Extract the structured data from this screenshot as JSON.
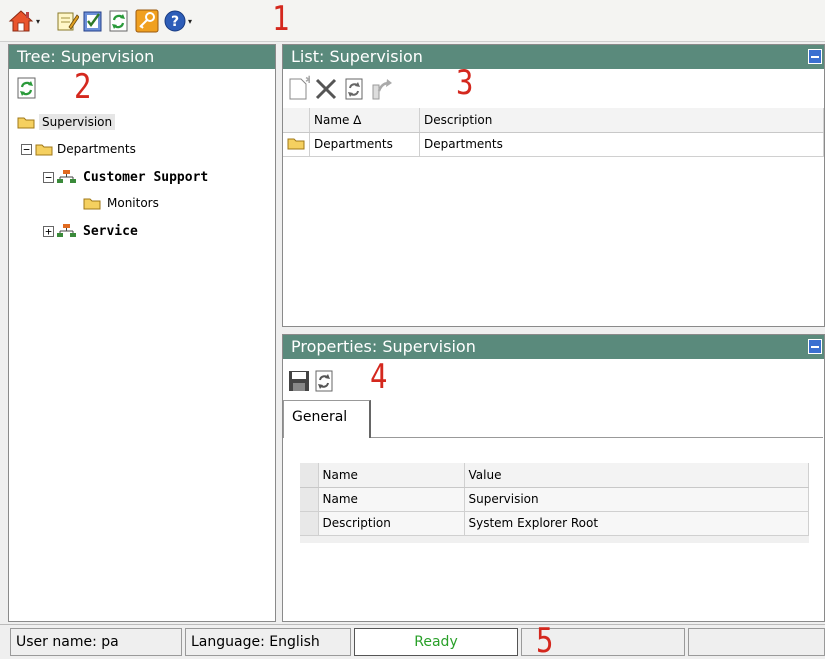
{
  "annotations": [
    "1",
    "2",
    "3",
    "4",
    "5"
  ],
  "toolbar": {
    "items": [
      {
        "icon": "home-icon"
      },
      {
        "icon": "edit-document-icon"
      },
      {
        "icon": "checklist-icon"
      },
      {
        "icon": "refresh-icon"
      },
      {
        "icon": "key-icon"
      },
      {
        "icon": "help-icon"
      }
    ]
  },
  "tree_panel": {
    "title": "Tree: Supervision",
    "refresh_icon": "refresh-icon",
    "nodes": [
      {
        "label": "Supervision",
        "icon": "folder-icon",
        "selected": true
      },
      {
        "label": "Departments",
        "icon": "folder-icon",
        "expander": "−"
      },
      {
        "label": "Customer Support",
        "icon": "org-chart-icon",
        "expander": "−",
        "bold": true
      },
      {
        "label": "Monitors",
        "icon": "folder-icon"
      },
      {
        "label": "Service",
        "icon": "org-chart-icon",
        "expander": "+",
        "bold": true
      }
    ]
  },
  "list_panel": {
    "title": "List: Supervision",
    "toolbar": [
      "new-document-icon",
      "delete-icon",
      "refresh-icon",
      "export-icon"
    ],
    "columns": [
      "Name ∆",
      "Description"
    ],
    "rows": [
      {
        "name": "Departments",
        "description": "Departments",
        "icon": "folder-icon"
      }
    ]
  },
  "properties_panel": {
    "title": "Properties: Supervision",
    "toolbar": [
      "save-icon",
      "refresh-icon"
    ],
    "tab": "General",
    "columns": [
      "Name",
      "Value"
    ],
    "rows": [
      {
        "name": "Name",
        "value": "Supervision"
      },
      {
        "name": "Description",
        "value": "System Explorer Root"
      }
    ]
  },
  "status_bar": {
    "user": "User name: pa",
    "language": "Language: English",
    "state": "Ready"
  },
  "colors": {
    "header_bg": "#5a8a7c",
    "annotation": "#d4281e",
    "ready_text": "#2aa02a"
  }
}
